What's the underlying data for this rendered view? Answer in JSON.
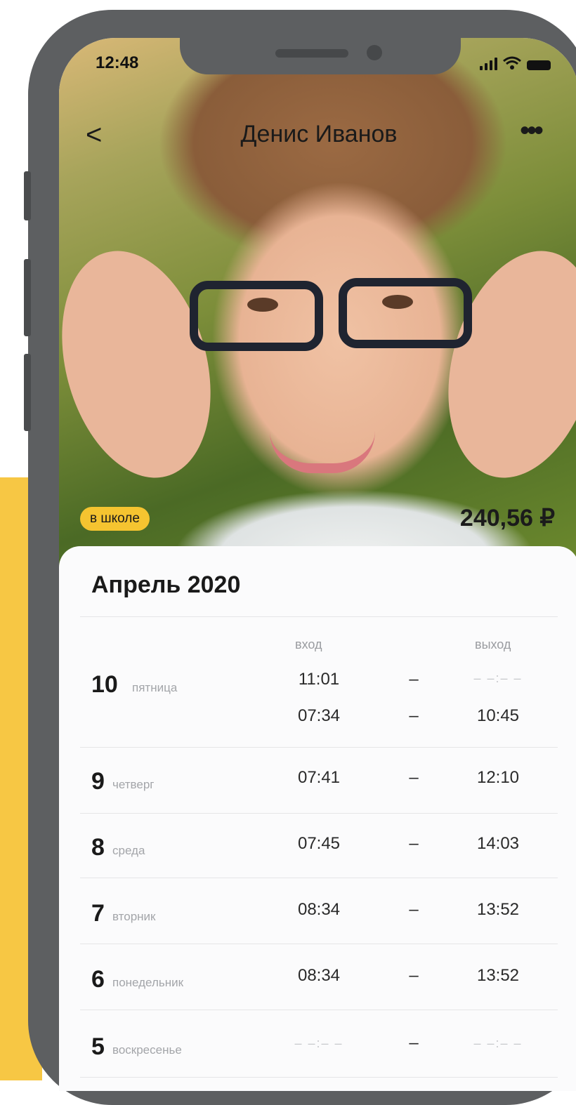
{
  "status": {
    "time": "12:48"
  },
  "header": {
    "back": "<",
    "title": "Денис Иванов",
    "more": "•••"
  },
  "profile": {
    "status_badge": "в школе",
    "balance": "240,56 ₽"
  },
  "calendar": {
    "month": "Апрель 2020",
    "col_in": "вход",
    "col_out": "выход",
    "rows": [
      {
        "day": "10",
        "weekday": "пятница",
        "in": "11:01",
        "out": "– –:– –",
        "in2": "07:34",
        "out2": "10:45",
        "dash": "–"
      },
      {
        "day": "9",
        "weekday": "четверг",
        "in": "07:41",
        "out": "12:10",
        "dash": "–"
      },
      {
        "day": "8",
        "weekday": "среда",
        "in": "07:45",
        "out": "14:03",
        "dash": "–"
      },
      {
        "day": "7",
        "weekday": "вторник",
        "in": "08:34",
        "out": "13:52",
        "dash": "–"
      },
      {
        "day": "6",
        "weekday": "понедельник",
        "in": "08:34",
        "out": "13:52",
        "dash": "–"
      },
      {
        "day": "5",
        "weekday": "воскресенье",
        "in": "– –:– –",
        "out": "– –:– –",
        "dash": "–"
      }
    ]
  },
  "colors": {
    "accent": "#f5c430",
    "background_accent": "#f7c744"
  }
}
